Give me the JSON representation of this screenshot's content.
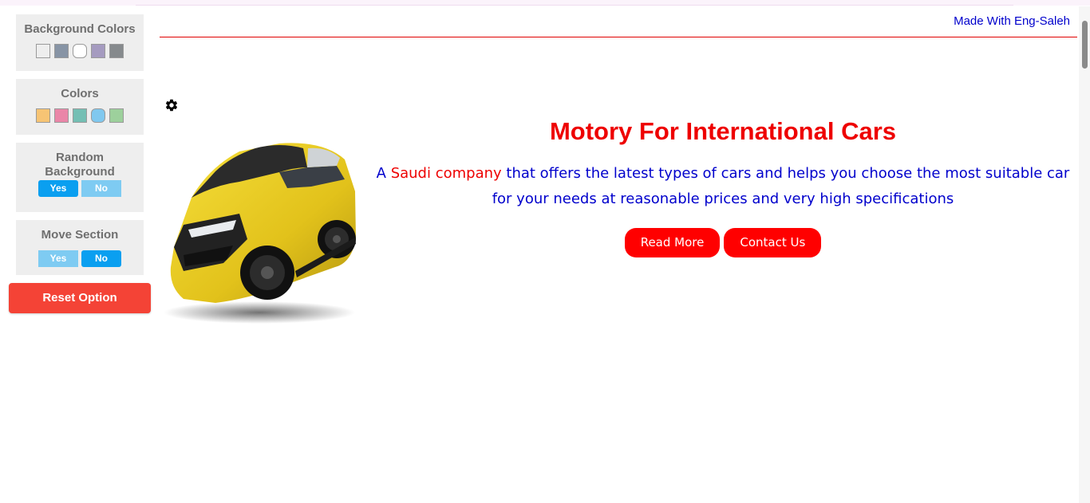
{
  "settings": {
    "background_colors": {
      "title": "Background Colors",
      "swatches": [
        "#eeeeee",
        "#8794a5",
        "#ffffff",
        "#a59bc0",
        "#868a8d"
      ]
    },
    "colors": {
      "title": "Colors",
      "swatches": [
        "#f7c474",
        "#ea86a8",
        "#74bfb4",
        "#80c8ef",
        "#9dd09c"
      ]
    },
    "random_background": {
      "title_line1": "Random",
      "title_line2": "Background",
      "yes": "Yes",
      "no": "No",
      "active": "yes"
    },
    "move_section": {
      "title": "Move Section",
      "yes": "Yes",
      "no": "No",
      "active": "no"
    },
    "reset_label": "Reset Option"
  },
  "header": {
    "credit": "Made With Eng-Saleh"
  },
  "hero": {
    "title": "Motory For International Cars",
    "desc_prefix": "A ",
    "desc_highlight": "Saudi company",
    "desc_rest": " that offers the latest types of cars and helps you choose the most suitable car for your needs at reasonable prices and very high specifications",
    "read_more": "Read More",
    "contact_us": "Contact Us"
  },
  "colors": {
    "accent_red": "#ee0000",
    "text_blue": "#0000cc",
    "toggle_active": "#0a9ff0",
    "toggle_inactive": "#7ecbf2",
    "reset_red": "#f44336"
  },
  "icons": {
    "gear": "gear-icon"
  }
}
